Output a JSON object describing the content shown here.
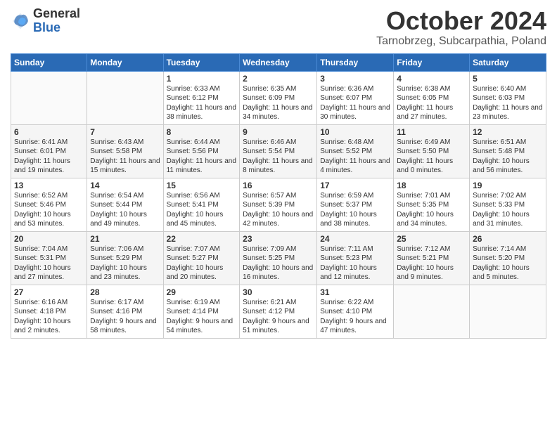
{
  "header": {
    "logo_general": "General",
    "logo_blue": "Blue",
    "month_title": "October 2024",
    "location": "Tarnobrzeg, Subcarpathia, Poland"
  },
  "weekdays": [
    "Sunday",
    "Monday",
    "Tuesday",
    "Wednesday",
    "Thursday",
    "Friday",
    "Saturday"
  ],
  "weeks": [
    [
      {
        "day": "",
        "sunrise": "",
        "sunset": "",
        "daylight": ""
      },
      {
        "day": "",
        "sunrise": "",
        "sunset": "",
        "daylight": ""
      },
      {
        "day": "1",
        "sunrise": "Sunrise: 6:33 AM",
        "sunset": "Sunset: 6:12 PM",
        "daylight": "Daylight: 11 hours and 38 minutes."
      },
      {
        "day": "2",
        "sunrise": "Sunrise: 6:35 AM",
        "sunset": "Sunset: 6:09 PM",
        "daylight": "Daylight: 11 hours and 34 minutes."
      },
      {
        "day": "3",
        "sunrise": "Sunrise: 6:36 AM",
        "sunset": "Sunset: 6:07 PM",
        "daylight": "Daylight: 11 hours and 30 minutes."
      },
      {
        "day": "4",
        "sunrise": "Sunrise: 6:38 AM",
        "sunset": "Sunset: 6:05 PM",
        "daylight": "Daylight: 11 hours and 27 minutes."
      },
      {
        "day": "5",
        "sunrise": "Sunrise: 6:40 AM",
        "sunset": "Sunset: 6:03 PM",
        "daylight": "Daylight: 11 hours and 23 minutes."
      }
    ],
    [
      {
        "day": "6",
        "sunrise": "Sunrise: 6:41 AM",
        "sunset": "Sunset: 6:01 PM",
        "daylight": "Daylight: 11 hours and 19 minutes."
      },
      {
        "day": "7",
        "sunrise": "Sunrise: 6:43 AM",
        "sunset": "Sunset: 5:58 PM",
        "daylight": "Daylight: 11 hours and 15 minutes."
      },
      {
        "day": "8",
        "sunrise": "Sunrise: 6:44 AM",
        "sunset": "Sunset: 5:56 PM",
        "daylight": "Daylight: 11 hours and 11 minutes."
      },
      {
        "day": "9",
        "sunrise": "Sunrise: 6:46 AM",
        "sunset": "Sunset: 5:54 PM",
        "daylight": "Daylight: 11 hours and 8 minutes."
      },
      {
        "day": "10",
        "sunrise": "Sunrise: 6:48 AM",
        "sunset": "Sunset: 5:52 PM",
        "daylight": "Daylight: 11 hours and 4 minutes."
      },
      {
        "day": "11",
        "sunrise": "Sunrise: 6:49 AM",
        "sunset": "Sunset: 5:50 PM",
        "daylight": "Daylight: 11 hours and 0 minutes."
      },
      {
        "day": "12",
        "sunrise": "Sunrise: 6:51 AM",
        "sunset": "Sunset: 5:48 PM",
        "daylight": "Daylight: 10 hours and 56 minutes."
      }
    ],
    [
      {
        "day": "13",
        "sunrise": "Sunrise: 6:52 AM",
        "sunset": "Sunset: 5:46 PM",
        "daylight": "Daylight: 10 hours and 53 minutes."
      },
      {
        "day": "14",
        "sunrise": "Sunrise: 6:54 AM",
        "sunset": "Sunset: 5:44 PM",
        "daylight": "Daylight: 10 hours and 49 minutes."
      },
      {
        "day": "15",
        "sunrise": "Sunrise: 6:56 AM",
        "sunset": "Sunset: 5:41 PM",
        "daylight": "Daylight: 10 hours and 45 minutes."
      },
      {
        "day": "16",
        "sunrise": "Sunrise: 6:57 AM",
        "sunset": "Sunset: 5:39 PM",
        "daylight": "Daylight: 10 hours and 42 minutes."
      },
      {
        "day": "17",
        "sunrise": "Sunrise: 6:59 AM",
        "sunset": "Sunset: 5:37 PM",
        "daylight": "Daylight: 10 hours and 38 minutes."
      },
      {
        "day": "18",
        "sunrise": "Sunrise: 7:01 AM",
        "sunset": "Sunset: 5:35 PM",
        "daylight": "Daylight: 10 hours and 34 minutes."
      },
      {
        "day": "19",
        "sunrise": "Sunrise: 7:02 AM",
        "sunset": "Sunset: 5:33 PM",
        "daylight": "Daylight: 10 hours and 31 minutes."
      }
    ],
    [
      {
        "day": "20",
        "sunrise": "Sunrise: 7:04 AM",
        "sunset": "Sunset: 5:31 PM",
        "daylight": "Daylight: 10 hours and 27 minutes."
      },
      {
        "day": "21",
        "sunrise": "Sunrise: 7:06 AM",
        "sunset": "Sunset: 5:29 PM",
        "daylight": "Daylight: 10 hours and 23 minutes."
      },
      {
        "day": "22",
        "sunrise": "Sunrise: 7:07 AM",
        "sunset": "Sunset: 5:27 PM",
        "daylight": "Daylight: 10 hours and 20 minutes."
      },
      {
        "day": "23",
        "sunrise": "Sunrise: 7:09 AM",
        "sunset": "Sunset: 5:25 PM",
        "daylight": "Daylight: 10 hours and 16 minutes."
      },
      {
        "day": "24",
        "sunrise": "Sunrise: 7:11 AM",
        "sunset": "Sunset: 5:23 PM",
        "daylight": "Daylight: 10 hours and 12 minutes."
      },
      {
        "day": "25",
        "sunrise": "Sunrise: 7:12 AM",
        "sunset": "Sunset: 5:21 PM",
        "daylight": "Daylight: 10 hours and 9 minutes."
      },
      {
        "day": "26",
        "sunrise": "Sunrise: 7:14 AM",
        "sunset": "Sunset: 5:20 PM",
        "daylight": "Daylight: 10 hours and 5 minutes."
      }
    ],
    [
      {
        "day": "27",
        "sunrise": "Sunrise: 6:16 AM",
        "sunset": "Sunset: 4:18 PM",
        "daylight": "Daylight: 10 hours and 2 minutes."
      },
      {
        "day": "28",
        "sunrise": "Sunrise: 6:17 AM",
        "sunset": "Sunset: 4:16 PM",
        "daylight": "Daylight: 9 hours and 58 minutes."
      },
      {
        "day": "29",
        "sunrise": "Sunrise: 6:19 AM",
        "sunset": "Sunset: 4:14 PM",
        "daylight": "Daylight: 9 hours and 54 minutes."
      },
      {
        "day": "30",
        "sunrise": "Sunrise: 6:21 AM",
        "sunset": "Sunset: 4:12 PM",
        "daylight": "Daylight: 9 hours and 51 minutes."
      },
      {
        "day": "31",
        "sunrise": "Sunrise: 6:22 AM",
        "sunset": "Sunset: 4:10 PM",
        "daylight": "Daylight: 9 hours and 47 minutes."
      },
      {
        "day": "",
        "sunrise": "",
        "sunset": "",
        "daylight": ""
      },
      {
        "day": "",
        "sunrise": "",
        "sunset": "",
        "daylight": ""
      }
    ]
  ]
}
